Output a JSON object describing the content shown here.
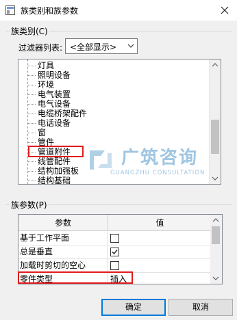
{
  "window": {
    "title": "族类别和族参数",
    "colors": {
      "titlebar": "#ffffff",
      "body": "#f0f0f0",
      "highlight": "#e01b1b"
    }
  },
  "family_category": {
    "group_label": "族类别(C)",
    "filter_label": "过滤器列表:",
    "filter_value": "<全部显示>",
    "items": [
      {
        "label": "灯具"
      },
      {
        "label": "照明设备"
      },
      {
        "label": "环境"
      },
      {
        "label": "电气装置"
      },
      {
        "label": "电气设备"
      },
      {
        "label": "电缆桥架配件"
      },
      {
        "label": "电话设备"
      },
      {
        "label": "窗"
      },
      {
        "label": "管件"
      },
      {
        "label": "管道附件"
      },
      {
        "label": "线管配件"
      },
      {
        "label": "结构加强板"
      },
      {
        "label": "结构基础"
      }
    ]
  },
  "watermark": {
    "text": "广筑咨询",
    "subtext": "GUANGZHU CONSULTATION"
  },
  "family_params": {
    "group_label": "族参数(P)",
    "columns": [
      "参数",
      "值"
    ],
    "rows": [
      {
        "name": "基于工作平面",
        "checked": false
      },
      {
        "name": "总是垂直",
        "checked": true
      },
      {
        "name": "加载时剪切的空心",
        "checked": false
      },
      {
        "name": "零件类型",
        "value": "插入"
      }
    ]
  },
  "buttons": {
    "ok": "确定",
    "cancel": "取消"
  }
}
